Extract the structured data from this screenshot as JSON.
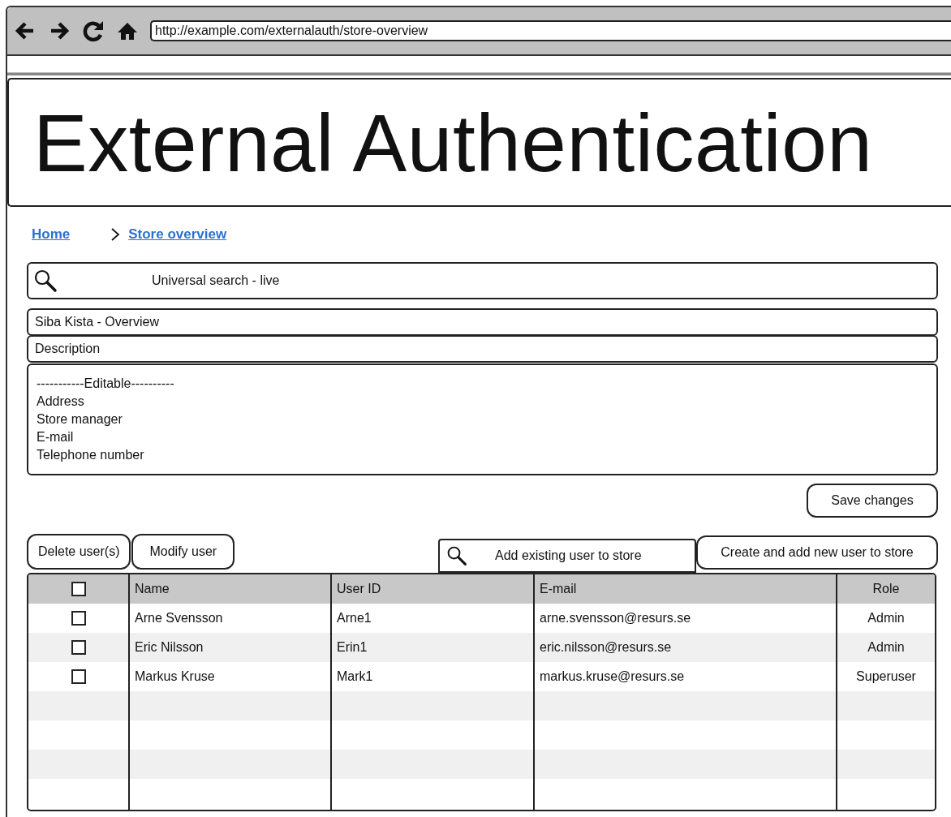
{
  "browser": {
    "url": "http://example.com/externalauth/store-overview"
  },
  "page_title": "External Authentication",
  "breadcrumb": [
    {
      "label": "Home"
    },
    {
      "label": "Store overview"
    }
  ],
  "search": {
    "placeholder": "Universal search - live"
  },
  "store_title": "Siba Kista - Overview",
  "description_label": "Description",
  "editable_lines": [
    "-----------Editable----------",
    "Address",
    "Store manager",
    "E-mail",
    "Telephone number"
  ],
  "save_button": "Save changes",
  "left_buttons": [
    "Delete user(s)",
    "Modify user"
  ],
  "add_existing": {
    "placeholder": "Add existing user to store"
  },
  "create_button": "Create and add new user to store",
  "table": {
    "select_all_checked": false,
    "columns": [
      "Name",
      "User ID",
      "E-mail",
      "Role"
    ],
    "rows": [
      {
        "checked": false,
        "cells": [
          "Arne Svensson",
          "Arne1",
          "arne.svensson@resurs.se",
          "Admin"
        ]
      },
      {
        "checked": false,
        "cells": [
          "Eric Nilsson",
          "Erin1",
          "eric.nilsson@resurs.se",
          "Admin"
        ]
      },
      {
        "checked": false,
        "cells": [
          "Markus Kruse",
          "Mark1",
          "markus.kruse@resurs.se",
          "Superuser"
        ]
      }
    ]
  }
}
